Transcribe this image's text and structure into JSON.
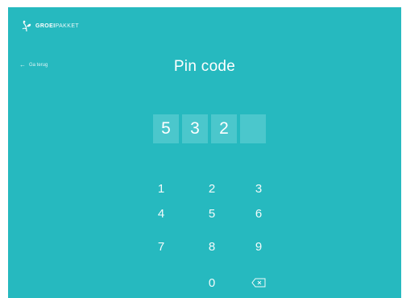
{
  "header": {
    "logo_bold": "GROEI",
    "logo_light": "PAKKET"
  },
  "nav": {
    "back_label": "Ga terug",
    "back_icon": "arrow-left-icon"
  },
  "page": {
    "title": "Pin code"
  },
  "pin": {
    "digits": [
      "5",
      "3",
      "2",
      ""
    ]
  },
  "keypad": {
    "keys": [
      "1",
      "2",
      "3",
      "4",
      "5",
      "6",
      "7",
      "8",
      "9",
      "0"
    ],
    "backspace_icon": "backspace-icon"
  },
  "colors": {
    "background": "#26b9bf",
    "pin_box": "#4bc7cc",
    "text": "#ffffff"
  }
}
